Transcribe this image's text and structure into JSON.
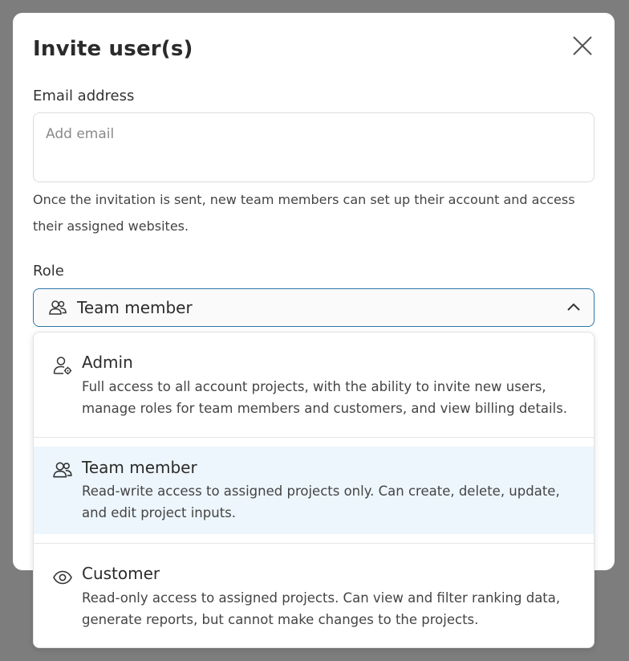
{
  "modal": {
    "title": "Invite user(s)",
    "close_icon": "close-icon"
  },
  "email": {
    "label": "Email address",
    "placeholder": "Add email",
    "value": "",
    "help_text": "Once the invitation is sent, new team members can set up their account and access their assigned websites."
  },
  "role": {
    "label": "Role",
    "selected": "Team member",
    "selected_icon": "team-icon",
    "chevron_icon": "chevron-up-icon",
    "options": [
      {
        "title": "Admin",
        "icon": "admin-gear-icon",
        "description": "Full access to all account projects, with the ability to invite new users, manage roles for team members and customers, and view billing details."
      },
      {
        "title": "Team member",
        "icon": "team-icon",
        "description": "Read-write access to assigned projects only. Can create, delete, update, and edit project inputs."
      },
      {
        "title": "Customer",
        "icon": "eye-icon",
        "description": "Read-only access to assigned projects. Can view and filter ranking data, generate reports, but cannot make changes to the projects."
      }
    ]
  },
  "colors": {
    "overlay": "#7d7d7d",
    "accent_border": "#2b77a8",
    "selected_bg": "#edf6fc"
  }
}
